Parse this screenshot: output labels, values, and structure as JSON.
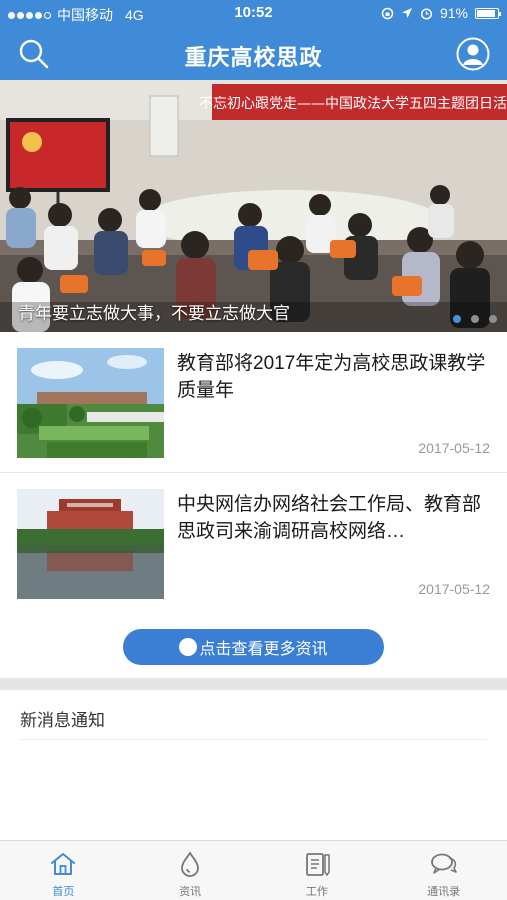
{
  "status_bar": {
    "carrier": "中国移动",
    "network": "4G",
    "time": "10:52",
    "battery": "91%",
    "battery_level": 0.91
  },
  "header": {
    "title": "重庆高校思政",
    "search_icon": "search-icon",
    "user_icon": "user-icon",
    "color": "#3f8bd8"
  },
  "banner": {
    "caption": "青年要立志做大事，不要立志做大官",
    "sign_text": "不忘初心跟党走——中国政法大学五四主题团日活动",
    "page_count": 3,
    "active_page": 1
  },
  "news": [
    {
      "title": "教育部将2017年定为高校思政课教学质量年",
      "date": "2017-05-12"
    },
    {
      "title": "中央网信办网络社会工作局、教育部思政司来渝调研高校网络…",
      "date": "2017-05-12"
    }
  ],
  "more_button": {
    "label": "点击查看更多资讯",
    "color": "#3b7fd4"
  },
  "notice": {
    "title": "新消息通知"
  },
  "tabs": [
    {
      "label": "首页",
      "icon": "home-icon",
      "active": true
    },
    {
      "label": "资讯",
      "icon": "drop-icon",
      "active": false
    },
    {
      "label": "工作",
      "icon": "document-icon",
      "active": false
    },
    {
      "label": "通讯录",
      "icon": "chat-icon",
      "active": false
    }
  ]
}
